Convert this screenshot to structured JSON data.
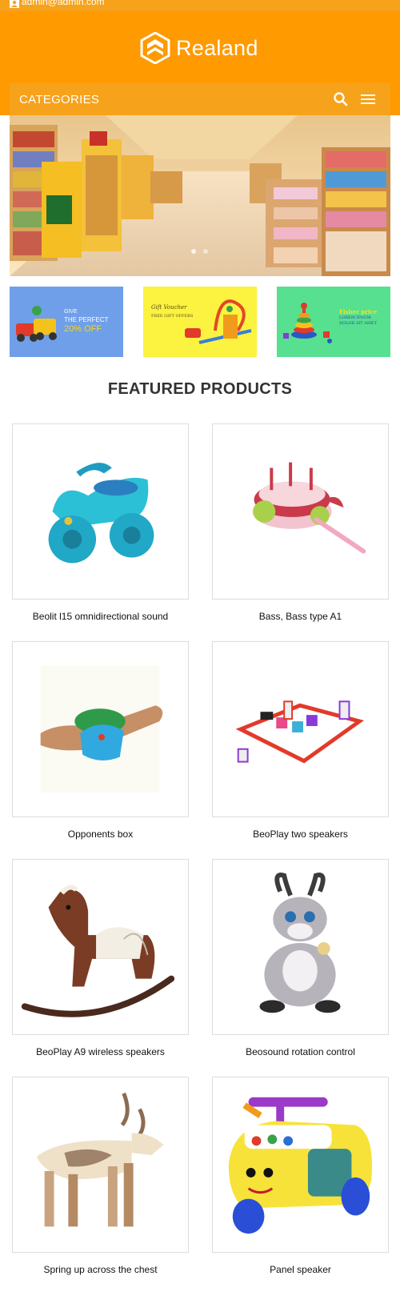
{
  "topbar": {
    "email": "admin@admin.com"
  },
  "brand": {
    "name": "Realand"
  },
  "nav": {
    "categories_label": "CATEGORIES"
  },
  "promos": [
    {
      "line1": "GIVE",
      "line2": "THE PERFECT",
      "line3": "20% OFF"
    },
    {
      "line1": "Gift Voucher",
      "line2": "FREE GIFT OFFERS"
    },
    {
      "line1": "Fisher price",
      "line2": "LOREM IPSUM DOLOR SIT AMET"
    }
  ],
  "featured": {
    "title": "FEATURED PRODUCTS",
    "products": [
      {
        "name": "Beolit l15 omnidirectional sound"
      },
      {
        "name": "Bass, Bass type A1"
      },
      {
        "name": "Opponents box"
      },
      {
        "name": "BeoPlay two speakers"
      },
      {
        "name": "BeoPlay A9 wireless speakers"
      },
      {
        "name": "Beosound rotation control"
      },
      {
        "name": "Spring up across the chest"
      },
      {
        "name": "Panel speaker"
      }
    ]
  },
  "colors": {
    "header": "#ff9a00",
    "bar": "#f7a21b",
    "title": "#333333"
  }
}
